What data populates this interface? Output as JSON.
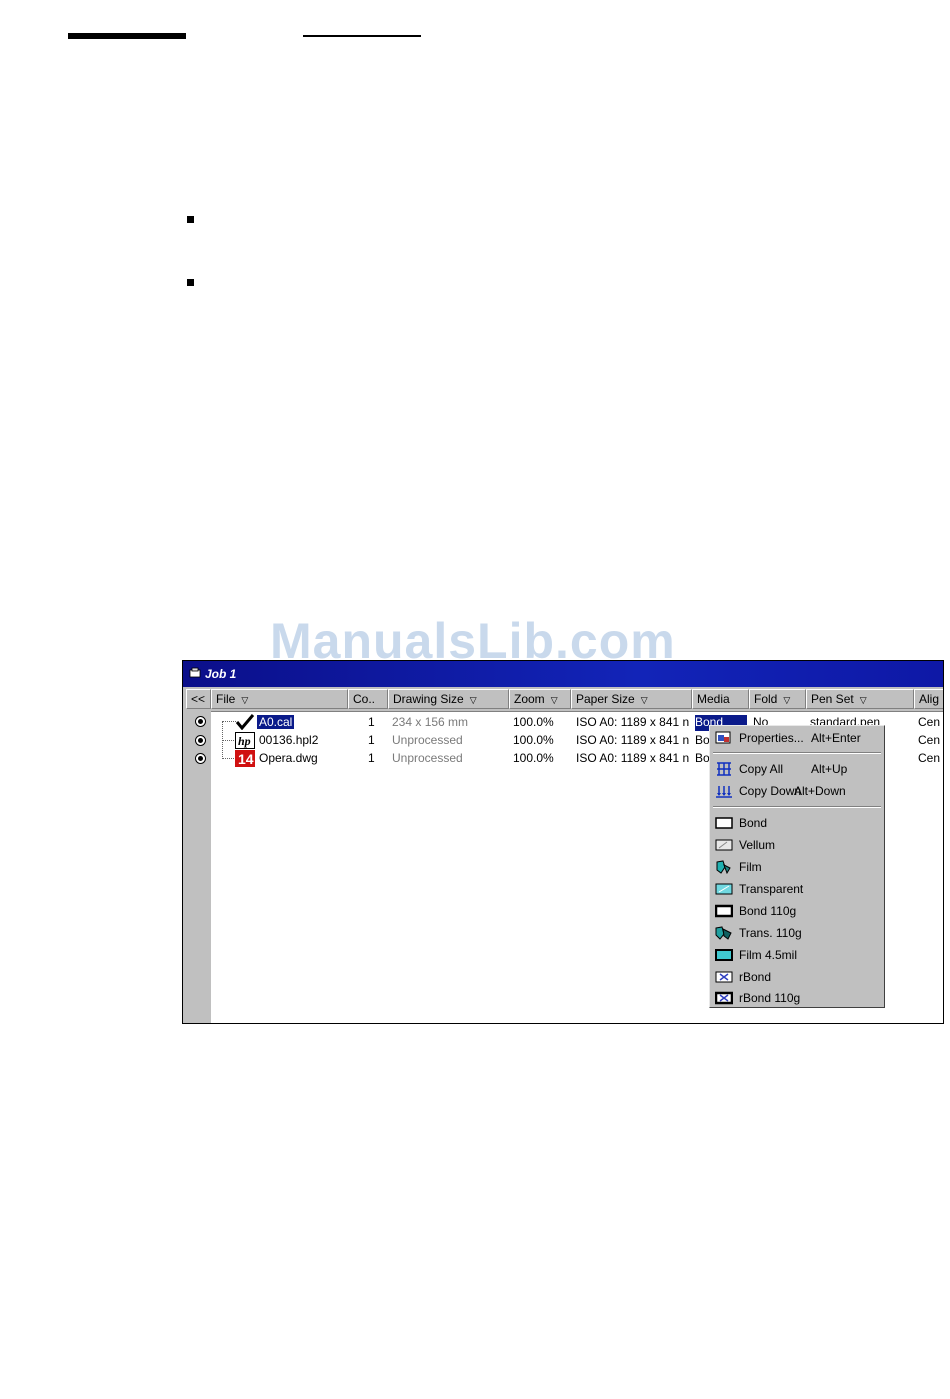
{
  "watermark": "ManualsLib.com",
  "window": {
    "title": "Job 1",
    "columns": [
      {
        "label": "<<",
        "arrow": ""
      },
      {
        "label": "File",
        "arrow": "▽"
      },
      {
        "label": "Co..",
        "arrow": ""
      },
      {
        "label": "Drawing Size",
        "arrow": "▽"
      },
      {
        "label": "Zoom",
        "arrow": "▽"
      },
      {
        "label": "Paper Size",
        "arrow": "▽"
      },
      {
        "label": "Media",
        "arrow": ""
      },
      {
        "label": "Fold",
        "arrow": "▽"
      },
      {
        "label": "Pen Set",
        "arrow": "▽"
      },
      {
        "label": "Alig",
        "arrow": ""
      }
    ],
    "rows": [
      {
        "file": "A0.cal",
        "copies": "1",
        "drawing_size": "234 x 156 mm",
        "zoom": "100.0%",
        "paper_size": "ISO A0: 1189 x 841 n",
        "media": "Bond",
        "fold": "No",
        "pen_set": "standard.pen",
        "align": "Cen",
        "icon": "check-icon"
      },
      {
        "file": "00136.hpl2",
        "copies": "1",
        "drawing_size": "Unprocessed",
        "zoom": "100.0%",
        "paper_size": "ISO A0: 1189 x 841 n",
        "media": "Bo",
        "fold": "",
        "pen_set": "",
        "align": "Cen",
        "icon": "hp-icon"
      },
      {
        "file": "Opera.dwg",
        "copies": "1",
        "drawing_size": "Unprocessed",
        "zoom": "100.0%",
        "paper_size": "ISO A0: 1189 x 841 n",
        "media": "Bo",
        "fold": "",
        "pen_set": "",
        "align": "Cen",
        "icon": "dwg-icon"
      }
    ]
  },
  "context_menu": {
    "items": [
      {
        "label": "Properties...",
        "accel": "Alt+Enter",
        "icon": "properties-icon"
      },
      {
        "label": "Copy All",
        "accel": "Alt+Up",
        "icon": "copy-all-icon"
      },
      {
        "label": "Copy Down",
        "accel": "Alt+Down",
        "icon": "copy-down-icon"
      },
      {
        "label": "Bond",
        "accel": "",
        "icon": "bond-media-icon"
      },
      {
        "label": "Vellum",
        "accel": "",
        "icon": "vellum-media-icon"
      },
      {
        "label": "Film",
        "accel": "",
        "icon": "film-media-icon"
      },
      {
        "label": "Transparent",
        "accel": "",
        "icon": "transparent-media-icon"
      },
      {
        "label": "Bond 110g",
        "accel": "",
        "icon": "bond-110g-media-icon"
      },
      {
        "label": "Trans. 110g",
        "accel": "",
        "icon": "trans-110g-media-icon"
      },
      {
        "label": "Film 4.5mil",
        "accel": "",
        "icon": "film-45mil-media-icon"
      },
      {
        "label": "rBond",
        "accel": "",
        "icon": "rbond-media-icon"
      },
      {
        "label": "rBond 110g",
        "accel": "",
        "icon": "rbond-110g-media-icon"
      }
    ]
  },
  "colors": {
    "titlebar": "#0b0f8a",
    "selection": "#0a1a8a",
    "face": "#c0c0c0"
  }
}
